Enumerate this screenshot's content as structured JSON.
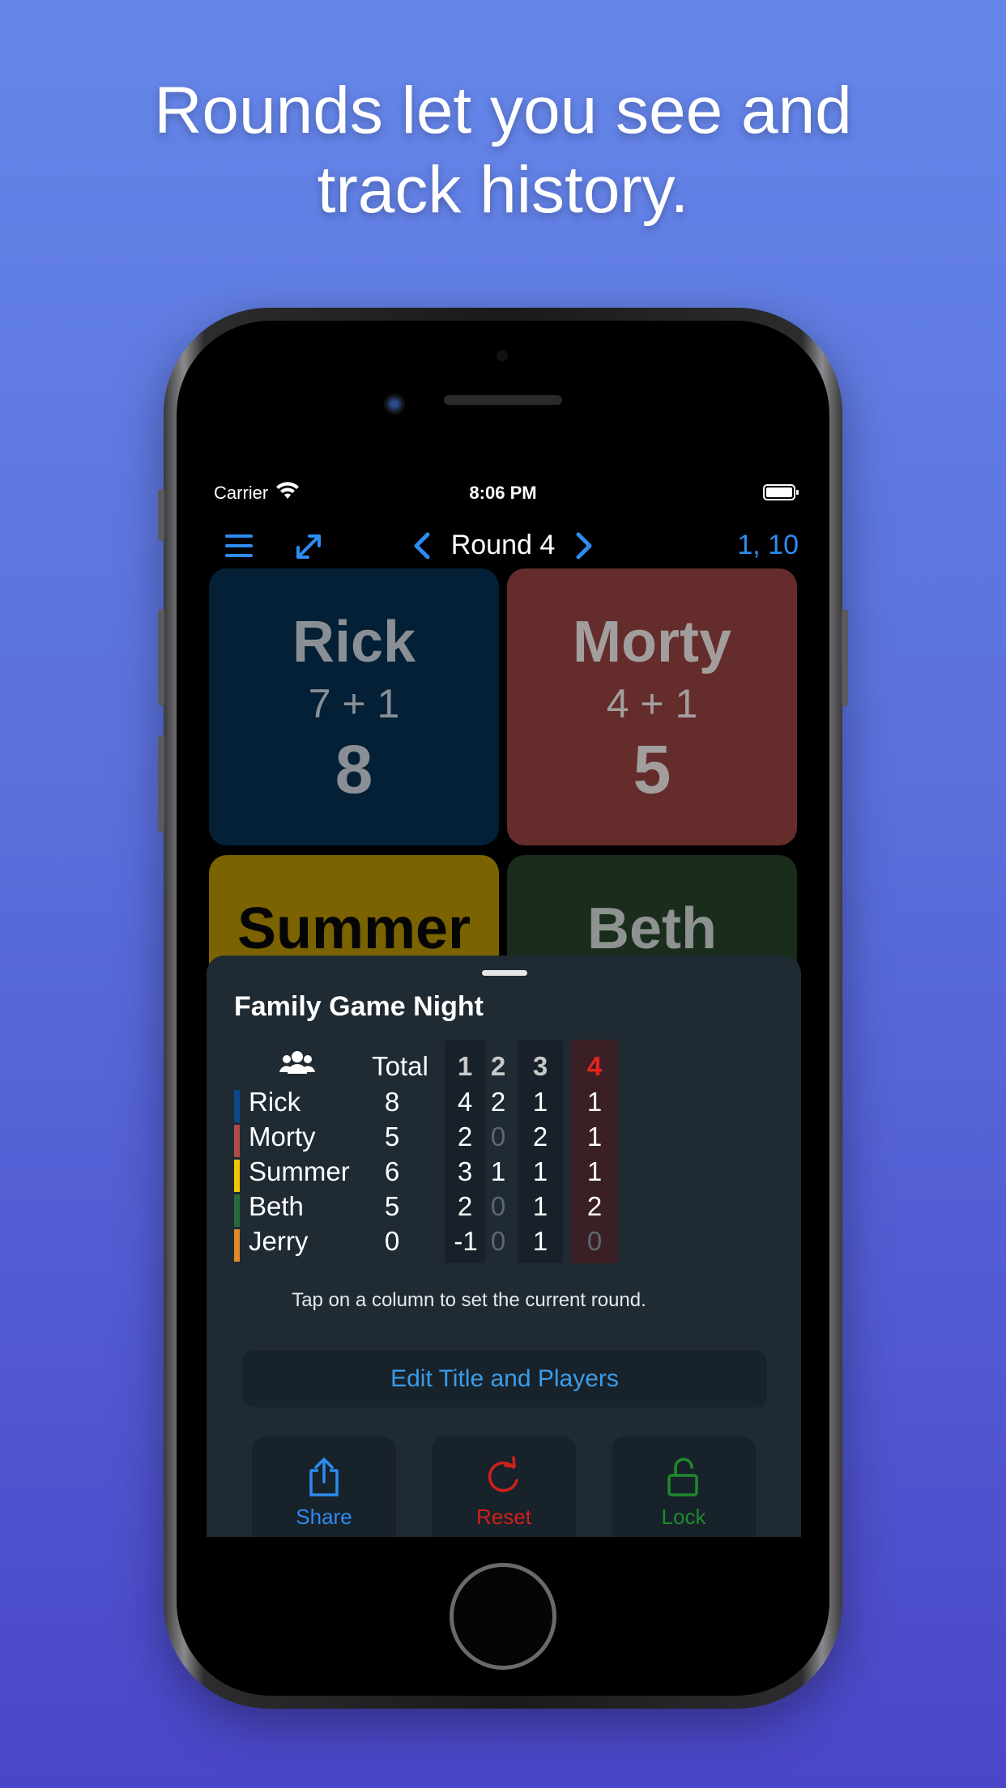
{
  "headline": {
    "line1": "Rounds let you see and",
    "line2": "track history."
  },
  "status_bar": {
    "carrier": "Carrier",
    "time": "8:06 PM"
  },
  "nav": {
    "round_title": "Round 4",
    "right_label": "1, 10"
  },
  "tiles": [
    {
      "name": "Rick",
      "expression": "7 + 1",
      "total": "8",
      "color": "#032036"
    },
    {
      "name": "Morty",
      "expression": "4 + 1",
      "total": "5",
      "color": "#642d2c"
    },
    {
      "name": "Summer",
      "expression": "",
      "total": "",
      "color": "#7a6300"
    },
    {
      "name": "Beth",
      "expression": "",
      "total": "",
      "color": "#1a2c1b"
    }
  ],
  "sheet": {
    "title": "Family Game Night",
    "total_header": "Total",
    "round_headers": [
      "1",
      "2",
      "3",
      "4"
    ],
    "current_round": "4",
    "players": [
      {
        "name": "Rick",
        "total": "8",
        "rounds": [
          "4",
          "2",
          "1",
          "1"
        ],
        "color": "#0a4a8a"
      },
      {
        "name": "Morty",
        "total": "5",
        "rounds": [
          "2",
          "0",
          "2",
          "1"
        ],
        "color": "#b24a47"
      },
      {
        "name": "Summer",
        "total": "6",
        "rounds": [
          "3",
          "1",
          "1",
          "1"
        ],
        "color": "#f0c800"
      },
      {
        "name": "Beth",
        "total": "5",
        "rounds": [
          "2",
          "0",
          "1",
          "2"
        ],
        "color": "#2a6a38"
      },
      {
        "name": "Jerry",
        "total": "0",
        "rounds": [
          "-1",
          "0",
          "1",
          "0"
        ],
        "color": "#e08a28"
      }
    ],
    "hint": "Tap on a column to set the current round.",
    "edit_button": "Edit Title and Players",
    "actions": {
      "share": "Share",
      "reset": "Reset",
      "lock": "Lock"
    }
  },
  "colors": {
    "accent_blue": "#2d8cf0",
    "reset_red": "#d0201a",
    "lock_green": "#1f8a2a"
  }
}
